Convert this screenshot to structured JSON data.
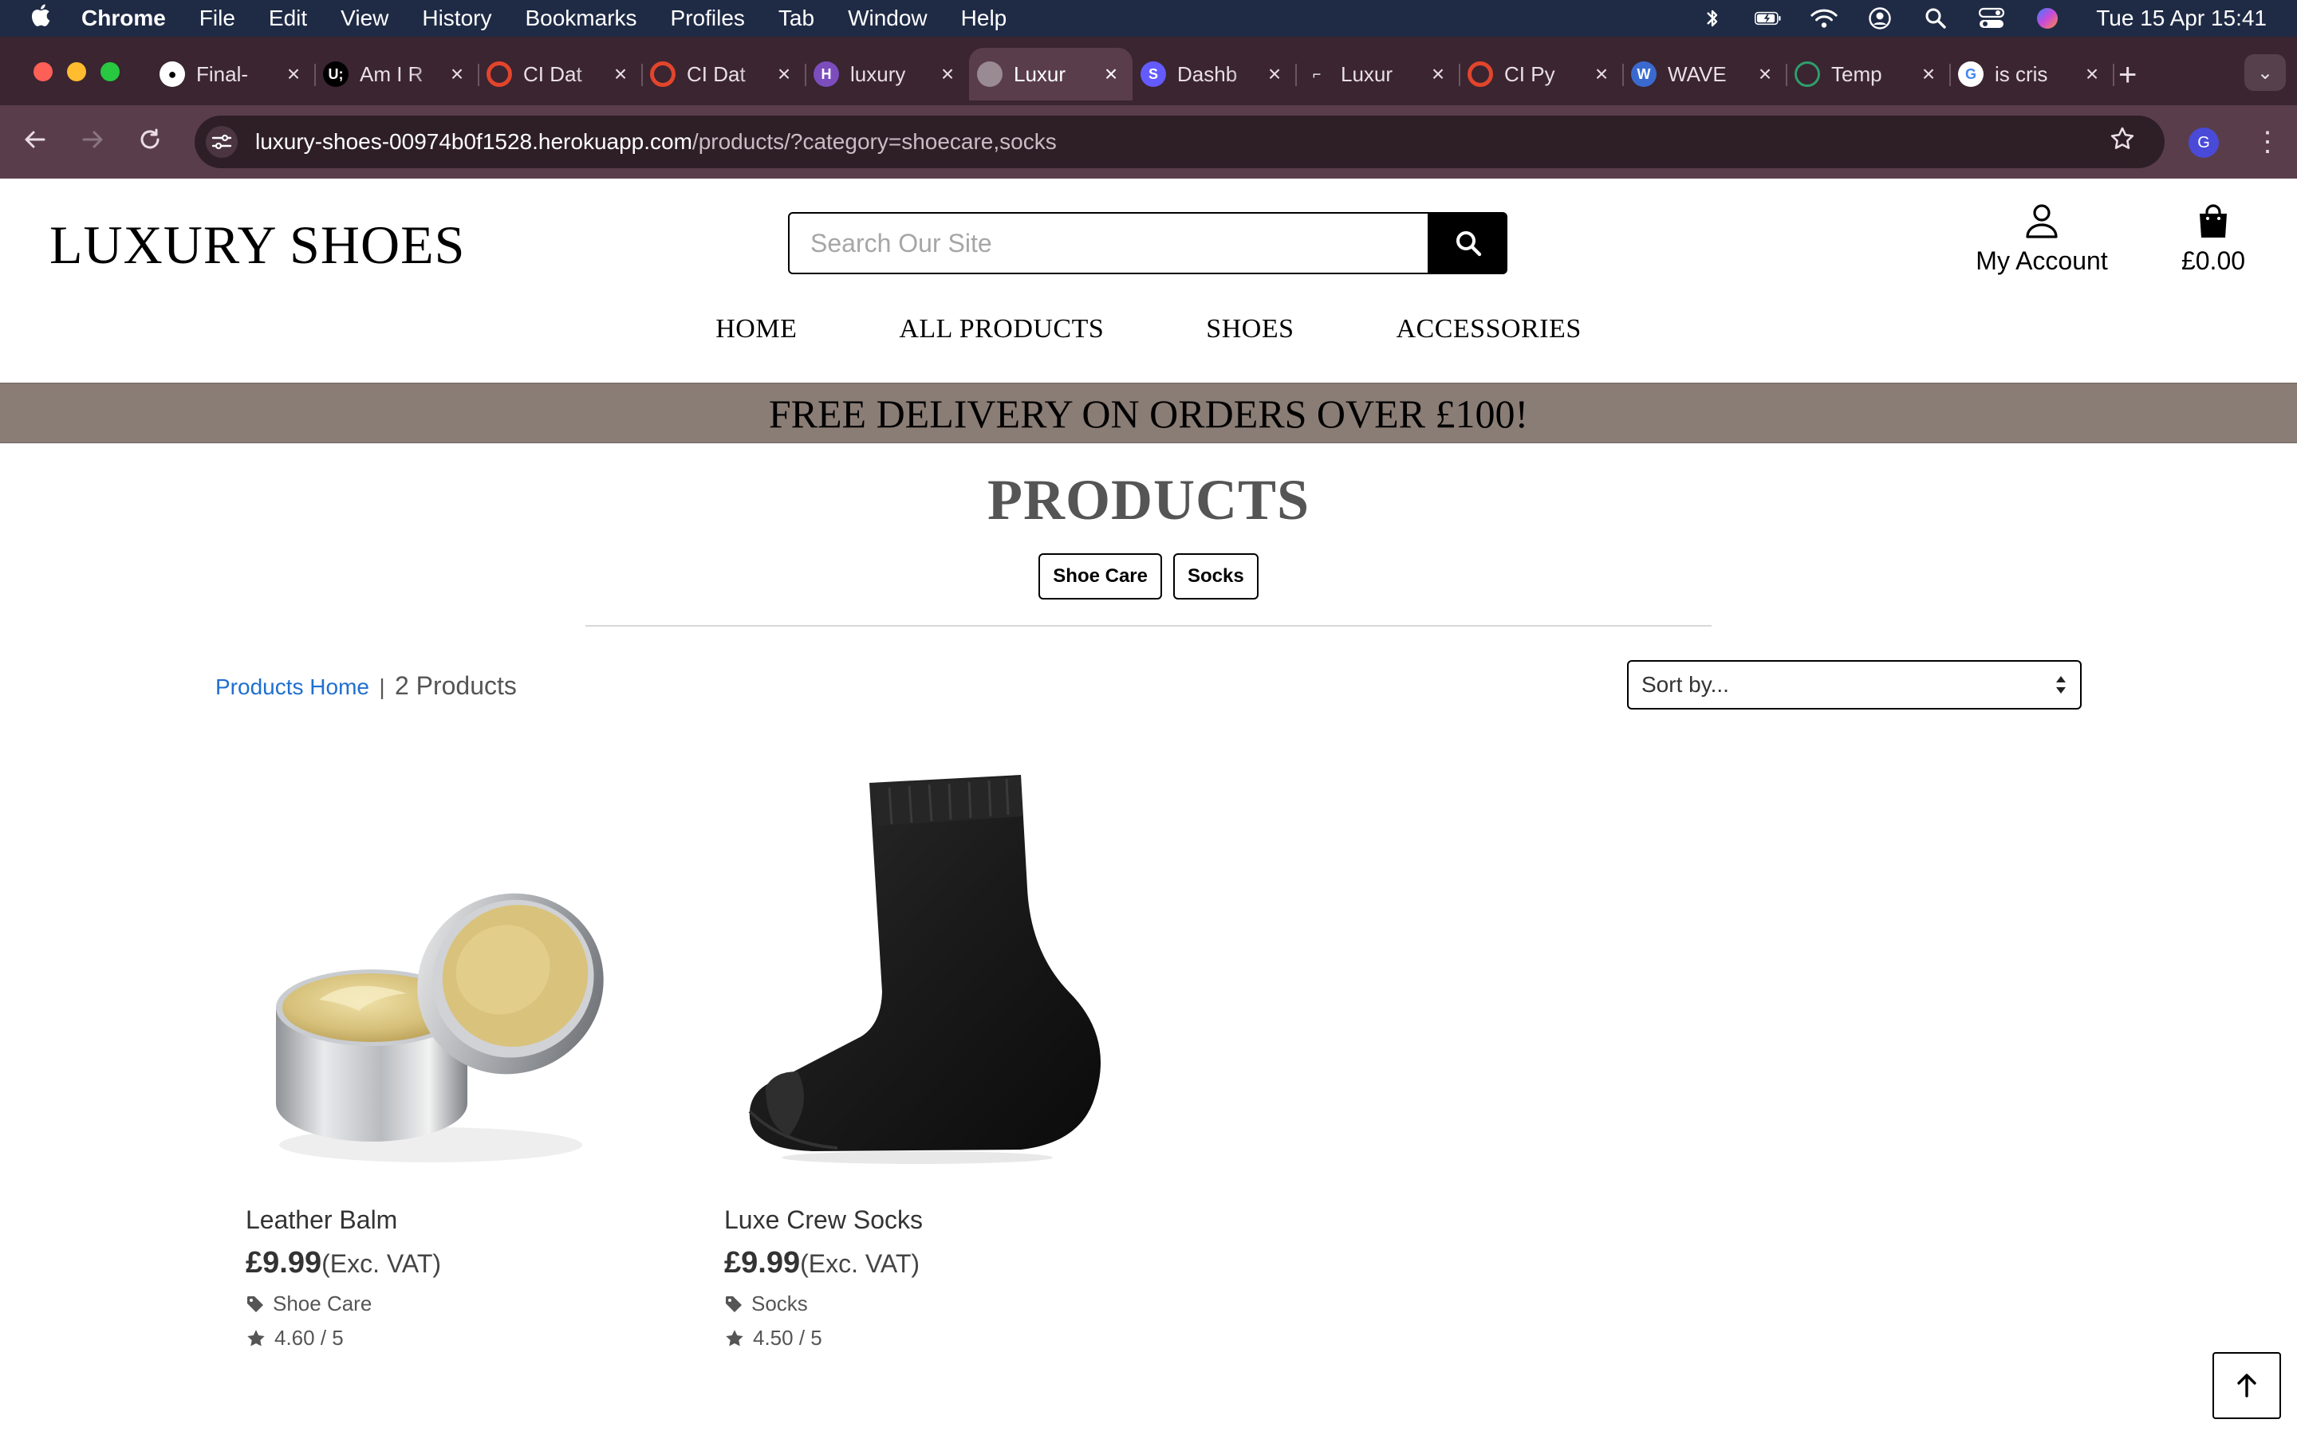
{
  "menubar": {
    "app": "Chrome",
    "items": [
      "File",
      "Edit",
      "View",
      "History",
      "Bookmarks",
      "Profiles",
      "Tab",
      "Window",
      "Help"
    ],
    "clock": "Tue 15 Apr  15:41",
    "status_icons": [
      "bluetooth-icon",
      "battery-icon",
      "wifi-icon",
      "user-icon",
      "spotlight-icon",
      "control-center-icon",
      "siri-icon"
    ]
  },
  "tabs": [
    {
      "title": "Final-",
      "icon": "github-icon",
      "color": "#ffffff",
      "glyph": ""
    },
    {
      "title": "Am I R",
      "icon": "ui-dev-icon",
      "color": "#000000",
      "glyph": "U;"
    },
    {
      "title": "CI Dat",
      "icon": "ci-icon",
      "color": "#e2452c",
      "glyph": ""
    },
    {
      "title": "CI Dat",
      "icon": "ci-icon",
      "color": "#e2452c",
      "glyph": ""
    },
    {
      "title": "luxury",
      "icon": "heroku-icon",
      "color": "#7c4dbd",
      "glyph": "H"
    },
    {
      "title": "Luxur",
      "icon": "globe-icon",
      "color": "#9a8a92",
      "glyph": "",
      "active": true
    },
    {
      "title": "Dashb",
      "icon": "stripe-icon",
      "color": "#635bff",
      "glyph": "S"
    },
    {
      "title": "Luxur",
      "icon": "shoe-icon",
      "color": "transparent",
      "glyph": ""
    },
    {
      "title": "CI Py",
      "icon": "ci-icon",
      "color": "#e2452c",
      "glyph": ""
    },
    {
      "title": "WAVE",
      "icon": "wave-icon",
      "color": "#3a6ad0",
      "glyph": "W"
    },
    {
      "title": "Temp",
      "icon": "template-icon",
      "color": "#2f9e6c",
      "glyph": ""
    },
    {
      "title": "is cris",
      "icon": "google-icon",
      "color": "#ffffff",
      "glyph": "G"
    }
  ],
  "toolbar": {
    "url_host": "luxury-shoes-00974b0f1528.herokuapp.com",
    "url_path": "/products/?category=shoecare,socks",
    "profile_initial": "G"
  },
  "site": {
    "logo": "LUXURY SHOES",
    "search_placeholder": "Search Our Site",
    "account_label": "My Account",
    "bag_total": "£0.00",
    "nav": [
      "HOME",
      "ALL PRODUCTS",
      "SHOES",
      "ACCESSORIES"
    ],
    "banner": "FREE DELIVERY ON ORDERS OVER £100!",
    "heading": "PRODUCTS",
    "category_buttons": [
      "Shoe Care",
      "Socks"
    ],
    "breadcrumb_link": "Products Home",
    "breadcrumb_sep": "|",
    "product_count": "2 Products",
    "sort_label": "Sort by..."
  },
  "products": [
    {
      "name": "Leather Balm",
      "price": "£9.99",
      "vat": "(Exc. VAT)",
      "category": "Shoe Care",
      "rating": "4.60 / 5"
    },
    {
      "name": "Luxe Crew Socks",
      "price": "£9.99",
      "vat": "(Exc. VAT)",
      "category": "Socks",
      "rating": "4.50 / 5"
    }
  ],
  "colors": {
    "banner_bg": "#8a7d76",
    "link": "#1f6fd0",
    "tabstrip_bg": "#3a2530",
    "toolbar_bg": "#5a3d4b"
  }
}
